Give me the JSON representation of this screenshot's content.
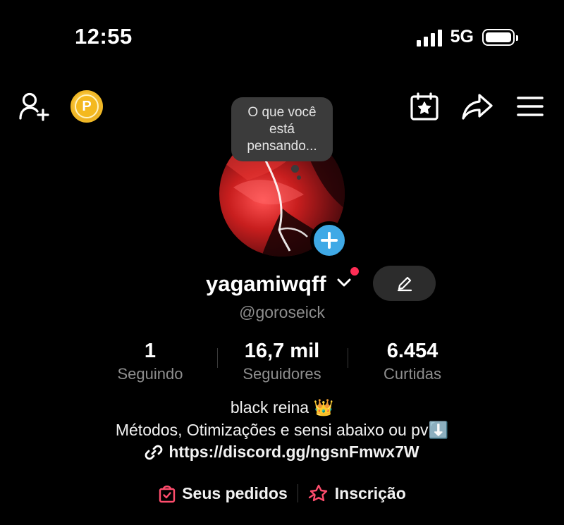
{
  "status_bar": {
    "time": "12:55",
    "network": "5G",
    "signal_bars": 4,
    "battery_level": 1.0
  },
  "top_bar": {
    "icons": [
      "add-user-icon",
      "coin-icon",
      "calendar-star-icon",
      "share-icon",
      "menu-icon"
    ],
    "coin_letter": "P"
  },
  "profile": {
    "thought_bubble": "O que você está pensando...",
    "username": "yagamiwqff",
    "handle": "@goroseick",
    "stats": [
      {
        "value": "1",
        "label": "Seguindo"
      },
      {
        "value": "16,7 mil",
        "label": "Seguidores"
      },
      {
        "value": "6.454",
        "label": "Curtidas"
      }
    ],
    "bio": {
      "line1": "black reina 👑",
      "line2": "Métodos, Otimizações e sensi abaixo ou pv⬇️",
      "link": "https://discord.gg/ngsnFmwx7W"
    },
    "actions": {
      "orders": "Seus pedidos",
      "subscription": "Inscrição"
    }
  },
  "colors": {
    "background": "#000000",
    "accent_blue": "#3fa9e6",
    "notify_red": "#ff2d55",
    "coin_gold": "#f4b91f",
    "muted_text": "#8e8e8e",
    "order_icon_red": "#ff4d6d"
  }
}
